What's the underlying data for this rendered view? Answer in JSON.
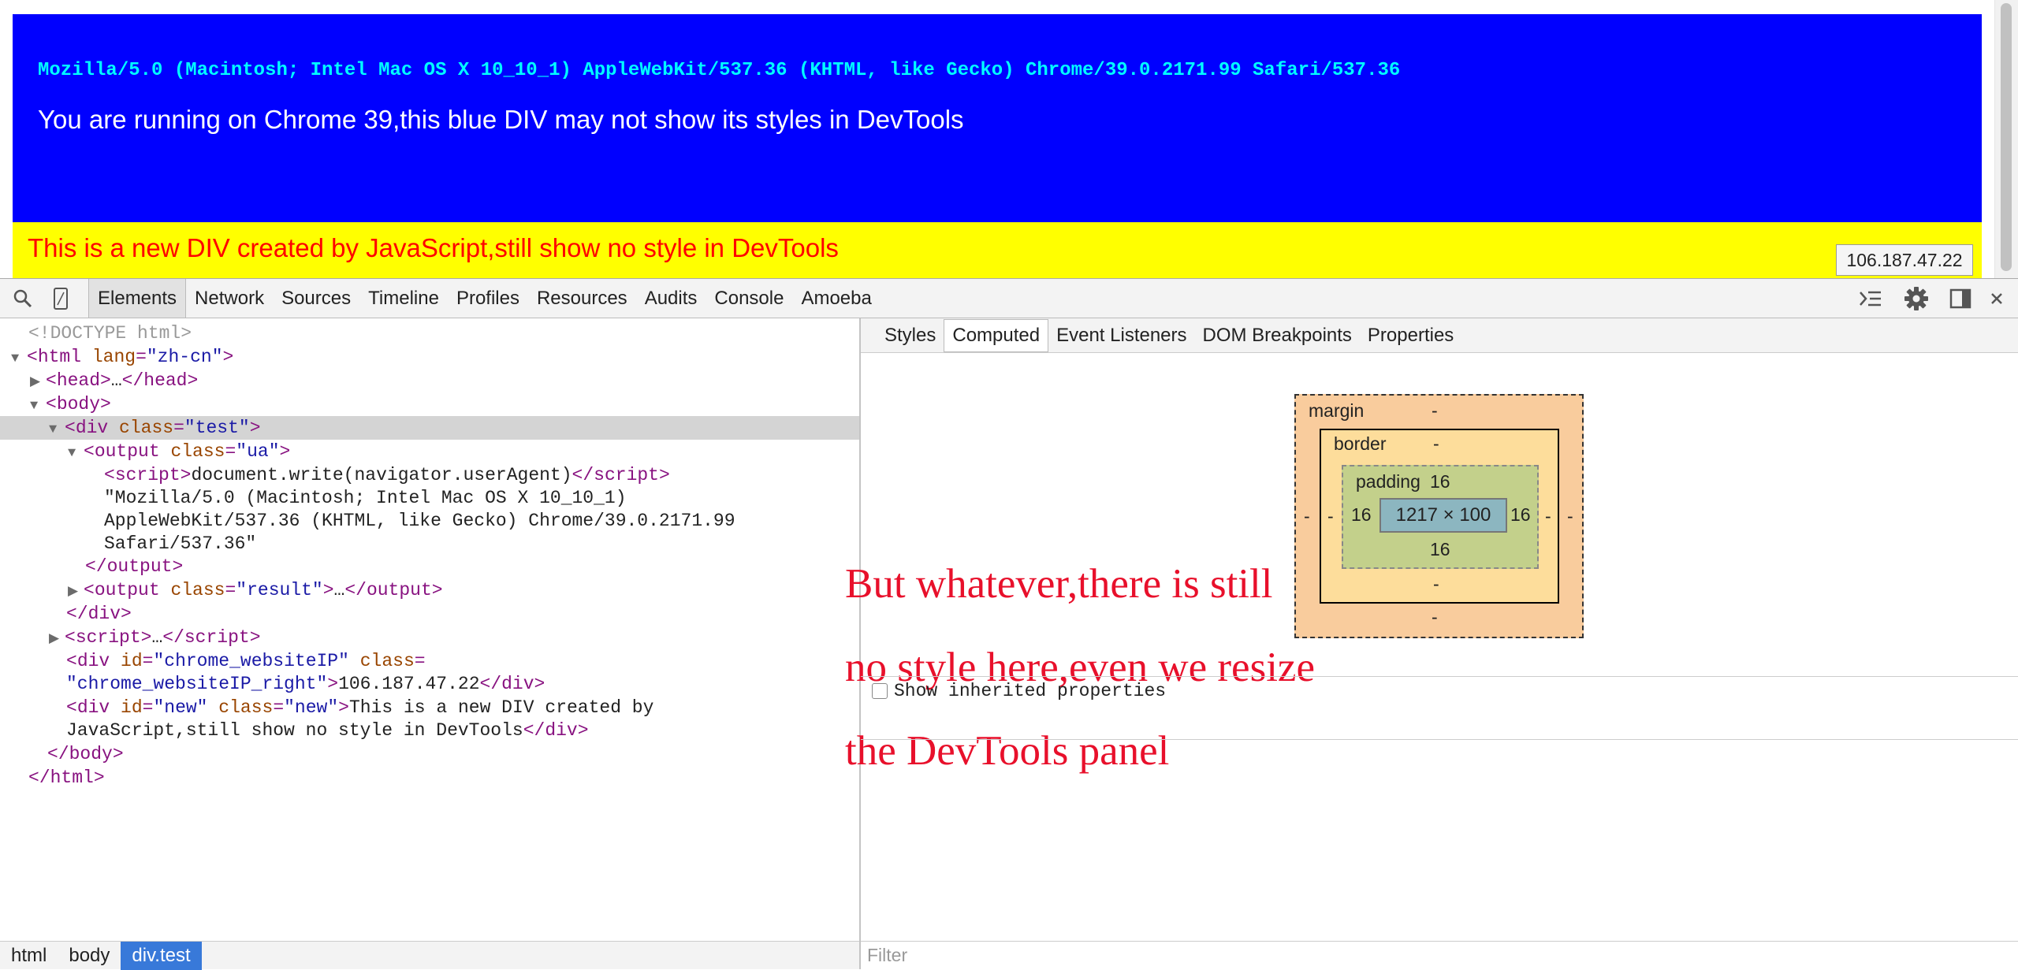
{
  "page": {
    "user_agent": "Mozilla/5.0 (Macintosh; Intel Mac OS X 10_10_1) AppleWebKit/537.36 (KHTML, like Gecko) Chrome/39.0.2171.99 Safari/537.36",
    "message": "You are running on Chrome 39,this blue DIV may not show its styles in DevTools",
    "new_div_text": "This is a new DIV created by JavaScript,still show no style in DevTools",
    "ip": "106.187.47.22",
    "colors": {
      "blue_div": "#0000ff",
      "ua_text": "#00ffff",
      "yellow_div": "#ffff00",
      "red_text": "#ff0000"
    }
  },
  "devtools": {
    "tabs": [
      "Elements",
      "Network",
      "Sources",
      "Timeline",
      "Profiles",
      "Resources",
      "Audits",
      "Console",
      "Amoeba"
    ],
    "active_tab": "Elements",
    "toolbar_icons": [
      "search-icon",
      "device-mode-icon",
      "console-drawer-icon",
      "gear-icon",
      "dock-icon",
      "close-icon"
    ],
    "dom": {
      "doctype": "<!DOCTYPE html>",
      "html_open": "html",
      "html_lang_attr": "lang",
      "html_lang_val": "\"zh-cn\"",
      "head": "head",
      "head_close": "/head",
      "body": "body",
      "div": "div",
      "class_attr": "class",
      "div_class_val": "\"test\"",
      "output": "output",
      "output_class_val": "\"ua\"",
      "script": "script",
      "script_close": "/script",
      "script_content": "document.write(navigator.userAgent)",
      "ua_line1": "\"Mozilla/5.0 (Macintosh; Intel Mac OS X 10_10_1)",
      "ua_line2": "AppleWebKit/537.36 (KHTML, like Gecko) Chrome/39.0.2171.99",
      "ua_line3": "Safari/537.36\"",
      "output_close": "/output",
      "output2_class_val": "\"result\"",
      "ellipsis": "…",
      "div_close": "/div",
      "id_attr": "id",
      "ip_id_val": "\"chrome_websiteIP\"",
      "ip_class_val": "\"chrome_websiteIP_right\"",
      "ip_text": "106.187.47.22",
      "new_id_val": "\"new\"",
      "new_class_val": "\"new\"",
      "new_text1": "This is a new DIV created by",
      "new_text2": "JavaScript,still show no style in DevTools",
      "body_close": "/body",
      "html_close": "/html"
    },
    "sidebar_tabs": [
      "Styles",
      "Computed",
      "Event Listeners",
      "DOM Breakpoints",
      "Properties"
    ],
    "active_sidebar_tab": "Computed",
    "box_model": {
      "margin_label": "margin",
      "border_label": "border",
      "padding_label": "padding",
      "dash": "-",
      "padding_top": "16",
      "padding_left": "16",
      "padding_right": "16",
      "padding_bottom": "16",
      "content": "1217 × 100"
    },
    "annotation": {
      "line1": "But whatever,there is still",
      "line2": "no style here,even we resize",
      "line3": "the DevTools panel",
      "color": "#e8102b"
    },
    "show_inherited_label": "Show inherited properties",
    "breadcrumbs": [
      "html",
      "body",
      "div.test"
    ],
    "active_breadcrumb": "div.test",
    "filter_placeholder": "Filter"
  }
}
